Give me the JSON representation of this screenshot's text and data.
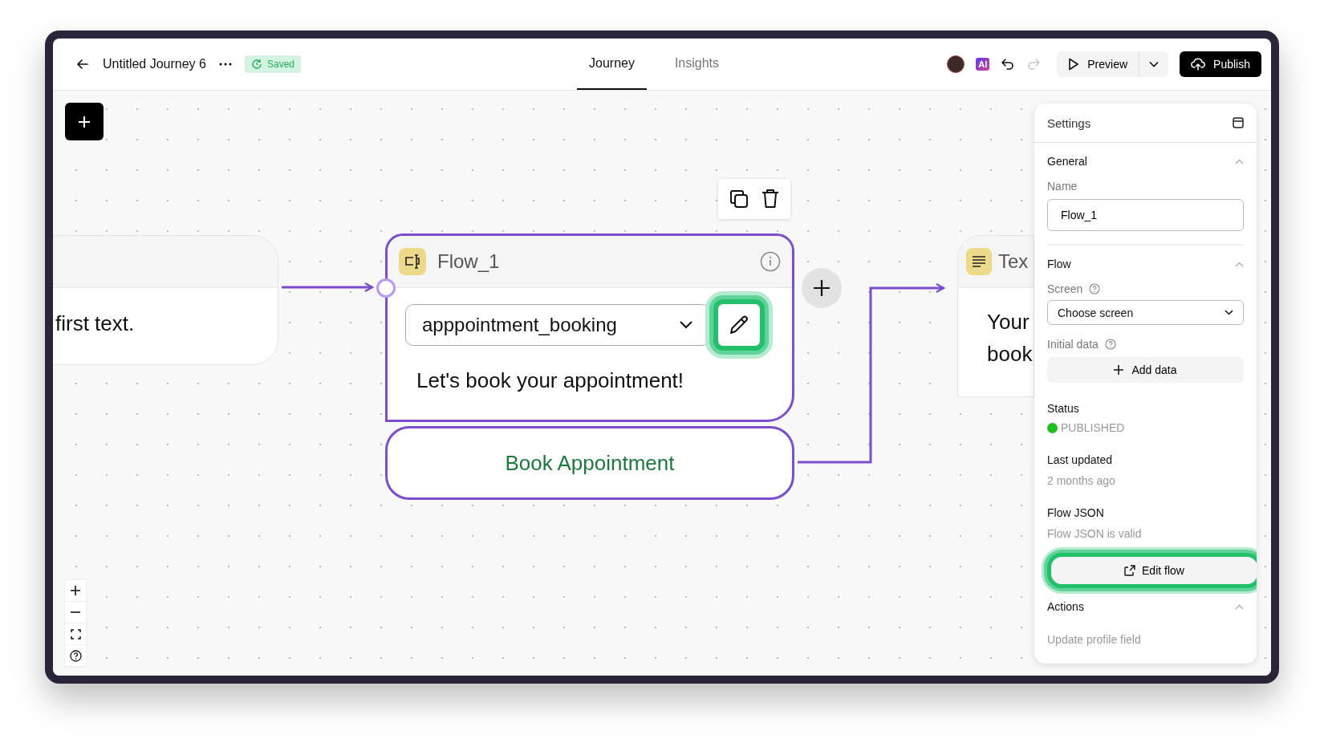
{
  "header": {
    "title": "Untitled Journey 6",
    "save_status": "Saved",
    "tabs": [
      {
        "label": "Journey",
        "selected": true
      },
      {
        "label": "Insights",
        "selected": false
      }
    ],
    "ai_badge": "AI",
    "redo_disabled": true,
    "preview": "Preview",
    "publish": "Publish"
  },
  "canvas": {
    "left_node": {
      "body": "first text."
    },
    "flow_node": {
      "title": "Flow_1",
      "flow_select": "apppointment_booking",
      "message": "Let's book your appointment!",
      "button": "Book Appointment"
    },
    "right_node": {
      "title": "Tex",
      "lines": [
        "Your",
        "book"
      ]
    }
  },
  "settings": {
    "title": "Settings",
    "general": {
      "heading": "General",
      "expanded": true,
      "name_label": "Name",
      "name_value": "Flow_1"
    },
    "flow": {
      "heading": "Flow",
      "expanded": true,
      "screen_label": "Screen",
      "screen_select": "Choose screen",
      "initial_data_label": "Initial data",
      "add_data": "Add data",
      "status_label": "Status",
      "status": {
        "text": "PUBLISHED",
        "color": "#1fbf1f"
      },
      "last_updated_label": "Last updated",
      "last_updated": "2 months ago",
      "json_label": "Flow JSON",
      "json_status": "Flow JSON is valid",
      "edit_flow": "Edit flow"
    },
    "actions": {
      "heading": "Actions",
      "expanded": true,
      "items": [
        "Update profile field"
      ]
    }
  }
}
